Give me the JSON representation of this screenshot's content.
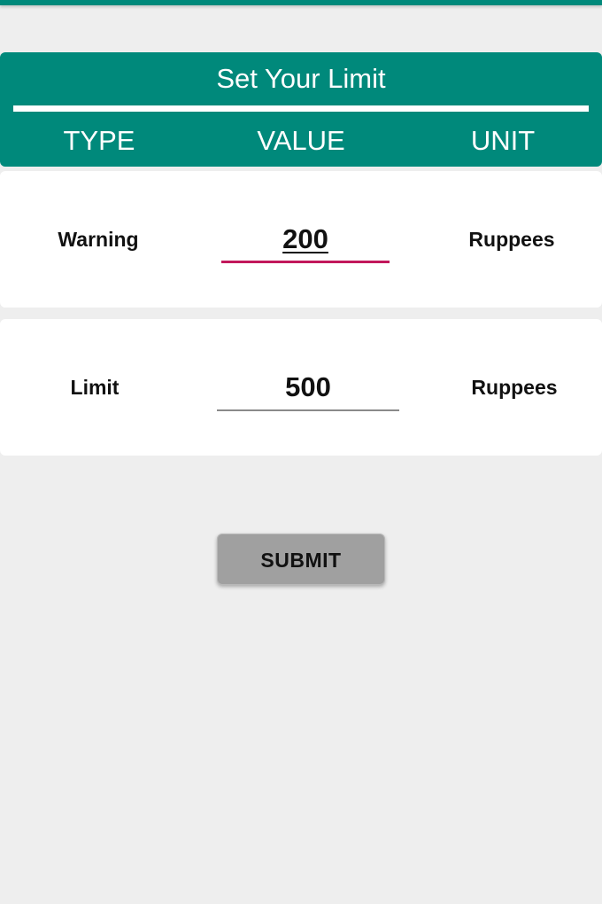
{
  "colors": {
    "primary": "#00897b",
    "accent": "#c2185b",
    "background": "#eeeeee",
    "card": "#ffffff",
    "button": "#a0a0a0"
  },
  "header": {
    "title": "Set Your Limit",
    "columns": {
      "type": "TYPE",
      "value": "VALUE",
      "unit": "UNIT"
    }
  },
  "rows": [
    {
      "type": "Warning",
      "value": "200",
      "unit": "Ruppees",
      "focused": true
    },
    {
      "type": "Limit",
      "value": "500",
      "unit": "Ruppees",
      "focused": false
    }
  ],
  "submit": {
    "label": "SUBMIT"
  }
}
